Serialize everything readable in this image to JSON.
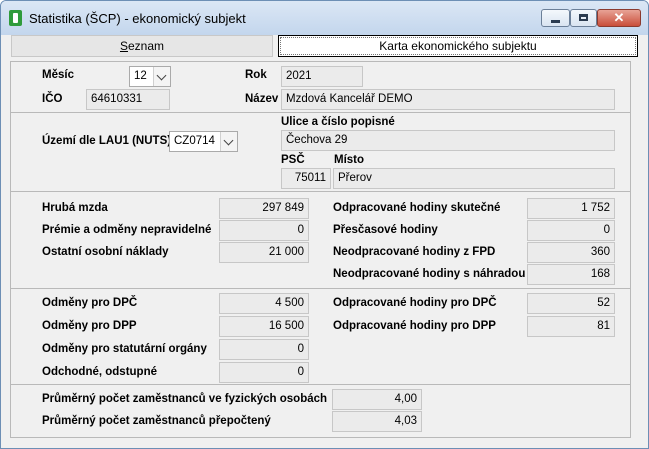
{
  "window": {
    "title": "Statistika (ŠCP) - ekonomický subjekt"
  },
  "tabs": {
    "seznam_prefix": "",
    "seznam_underlined": "S",
    "seznam_rest": "eznam",
    "karta": "Karta ekonomického subjektu"
  },
  "header": {
    "mesic_label": "Měsíc",
    "mesic_value": "12",
    "rok_label": "Rok",
    "rok_value": "2021",
    "ico_label": "IČO",
    "ico_value": "64610331",
    "nazev_label": "Název",
    "nazev_value": "Mzdová Kancelář DEMO"
  },
  "address": {
    "uzemi_label": "Území dle LAU1 (NUTS)",
    "uzemi_value": "CZ0714",
    "ulice_label": "Ulice a číslo popisné",
    "ulice_value": "Čechova 29",
    "psc_label": "PSČ",
    "psc_value": "75011",
    "misto_label": "Místo",
    "misto_value": "Přerov"
  },
  "wages": {
    "hruba_label": "Hrubá mzda",
    "hruba_value": "297 849",
    "premie_label": "Prémie a odměny nepravidelné",
    "premie_value": "0",
    "ostatni_label": "Ostatní osobní náklady",
    "ostatni_value": "21 000",
    "odprac_label": "Odpracované hodiny skutečné",
    "odprac_value": "1 752",
    "prescas_label": "Přesčasové hodiny",
    "prescas_value": "0",
    "neodprac_fpd_label": "Neodpracované hodiny z FPD",
    "neodprac_fpd_value": "360",
    "neodprac_nahr_label": "Neodpracované hodiny s náhradou",
    "neodprac_nahr_value": "168"
  },
  "other": {
    "dpc_label": "Odměny pro DPČ",
    "dpc_value": "4 500",
    "dpp_label": "Odměny pro DPP",
    "dpp_value": "16 500",
    "stat_label": "Odměny pro statutární orgány",
    "stat_value": "0",
    "odch_label": "Odchodné, odstupné",
    "odch_value": "0",
    "hod_dpc_label": "Odpracované hodiny pro DPČ",
    "hod_dpc_value": "52",
    "hod_dpp_label": "Odpracované hodiny pro DPP",
    "hod_dpp_value": "81"
  },
  "employees": {
    "fyz_label": "Průměrný počet zaměstnanců ve fyzických osobách",
    "fyz_value": "4,00",
    "prep_label": "Průměrný počet zaměstnanců přepočtený",
    "prep_value": "4,03"
  }
}
